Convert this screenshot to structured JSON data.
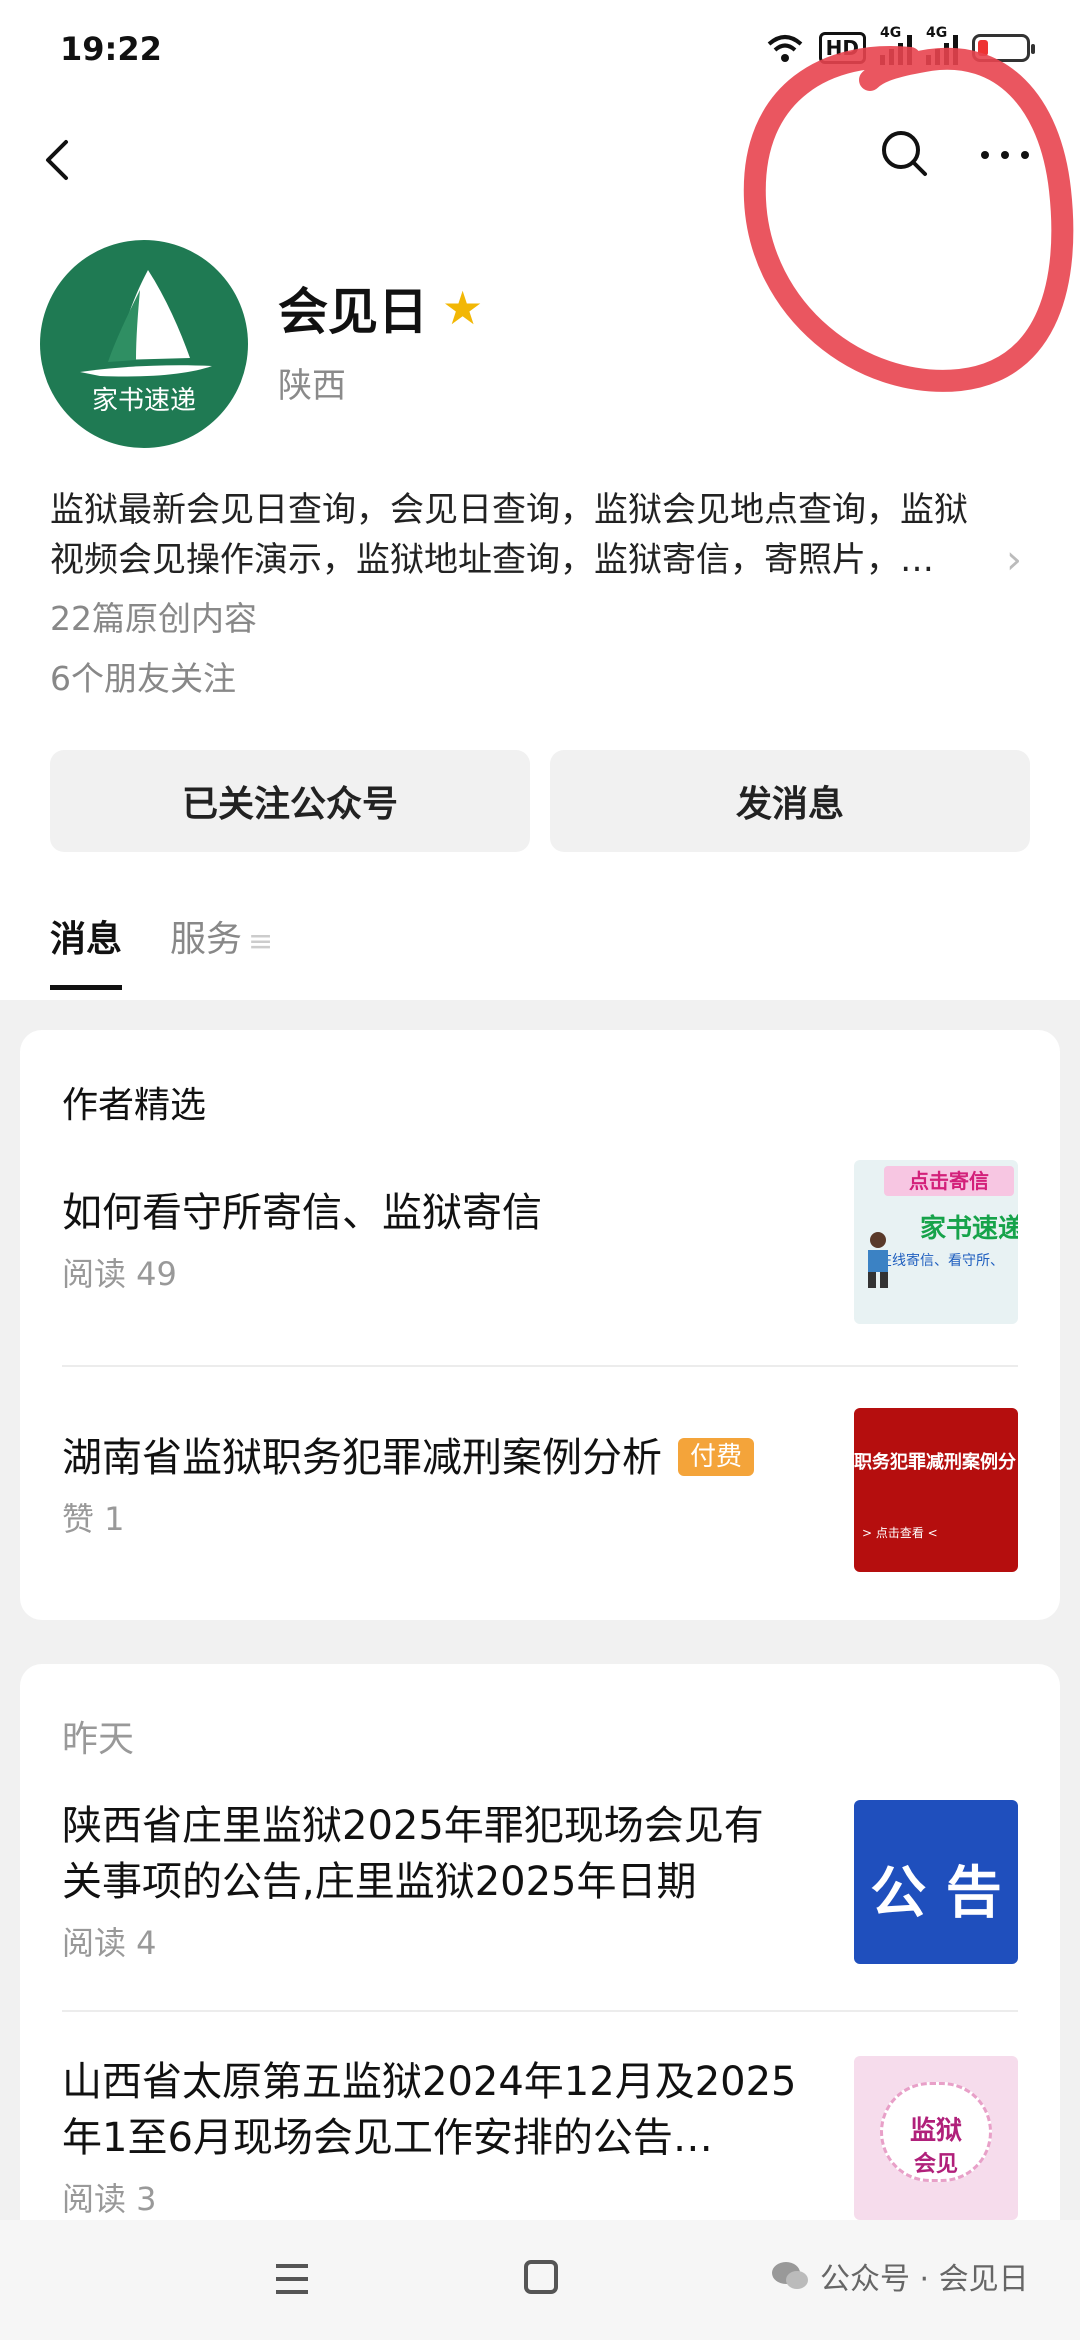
{
  "status": {
    "time": "19:22",
    "hd": "HD",
    "net1": "4G",
    "net2": "4G"
  },
  "account": {
    "name": "会见日",
    "location": "陕西",
    "logo_text": "家书速递"
  },
  "description": {
    "line1": "监狱最新会见日查询，会见日查询，监狱会见地点查询，监狱",
    "line2": "视频会见操作演示，监狱地址查询，监狱寄信，寄照片，…"
  },
  "meta": {
    "articles": "22篇原创内容",
    "friends": "6个朋友关注"
  },
  "buttons": {
    "follow": "已关注公众号",
    "message": "发消息"
  },
  "tabs": {
    "messages": "消息",
    "services": "服务"
  },
  "featured": {
    "title": "作者精选",
    "items": [
      {
        "title": "如何看守所寄信、监狱寄信",
        "sub": "阅读 49",
        "thumb_line1": "点击寄信",
        "thumb_line2": "家书速递",
        "thumb_line3": "在线寄信、看守所、"
      },
      {
        "title": "湖南省监狱职务犯罪减刑案例分析",
        "badge": "付费",
        "sub": "赞 1",
        "thumb_line1": "职务犯罪减刑案例分",
        "thumb_line2": "> 点击查看 <"
      }
    ]
  },
  "yesterday": {
    "title": "昨天",
    "items": [
      {
        "title_l1": "陕西省庄里监狱2025年罪犯现场会见有",
        "title_l2": "关事项的公告,庄里监狱2025年日期",
        "sub": "阅读 4",
        "thumb_text": "公 告"
      },
      {
        "title_l1": "山西省太原第五监狱2024年12月及2025",
        "title_l2": "年1至6月现场会见工作安排的公告…",
        "sub": "阅读 3",
        "thumb_line1": "监狱",
        "thumb_line2": "会见"
      }
    ]
  },
  "watermark": "公众号 · 会见日"
}
